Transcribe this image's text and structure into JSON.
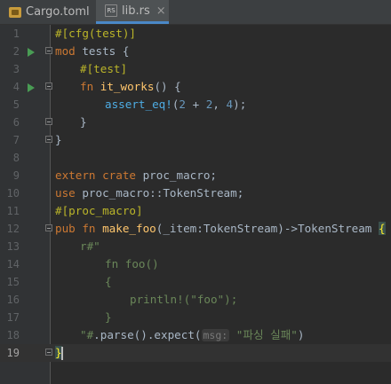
{
  "tabs": [
    {
      "label": "Cargo.toml",
      "icon": "cargo-file-icon",
      "active": false
    },
    {
      "label": "lib.rs",
      "icon": "rust-file-icon",
      "icon_text": "RS",
      "active": true,
      "close": "×"
    }
  ],
  "editor": {
    "current_line": 19,
    "line_numbers": [
      "1",
      "2",
      "3",
      "4",
      "5",
      "6",
      "7",
      "8",
      "9",
      "10",
      "11",
      "12",
      "13",
      "14",
      "15",
      "16",
      "17",
      "18",
      "19"
    ],
    "inlay_hint": "msg:",
    "lines": {
      "l1_attr": "#[cfg(test)]",
      "l2_kw": "mod",
      "l2_rest": " tests {",
      "l3_attr": "#[test]",
      "l4_kw": "fn",
      "l4_fn": "it_works",
      "l4_rest": "() {",
      "l5_mac": "assert_eq!",
      "l5_open": "(",
      "l5_n1": "2",
      "l5_plus": " + ",
      "l5_n2": "2",
      "l5_sep": ", ",
      "l5_n3": "4",
      "l5_close": ");",
      "l6": "}",
      "l7": "}",
      "l9_kw": "extern crate",
      "l9_rest": " proc_macro;",
      "l10_kw": "use",
      "l10_rest": " proc_macro::TokenStream;",
      "l11_attr": "#[proc_macro]",
      "l12_kw": "pub fn",
      "l12_fn": "make_foo",
      "l12_rest": "(_item:TokenStream)->TokenStream ",
      "l12_brace": "{",
      "l13": "r#\"",
      "l14": "fn foo()",
      "l15": "{",
      "l16": "println!(\"foo\");",
      "l17": "}",
      "l18_str": "\"#",
      "l18_rest": ".parse().expect(",
      "l18_arg": "\"파싱 실패\"",
      "l18_close": ")",
      "l19": "}"
    }
  }
}
